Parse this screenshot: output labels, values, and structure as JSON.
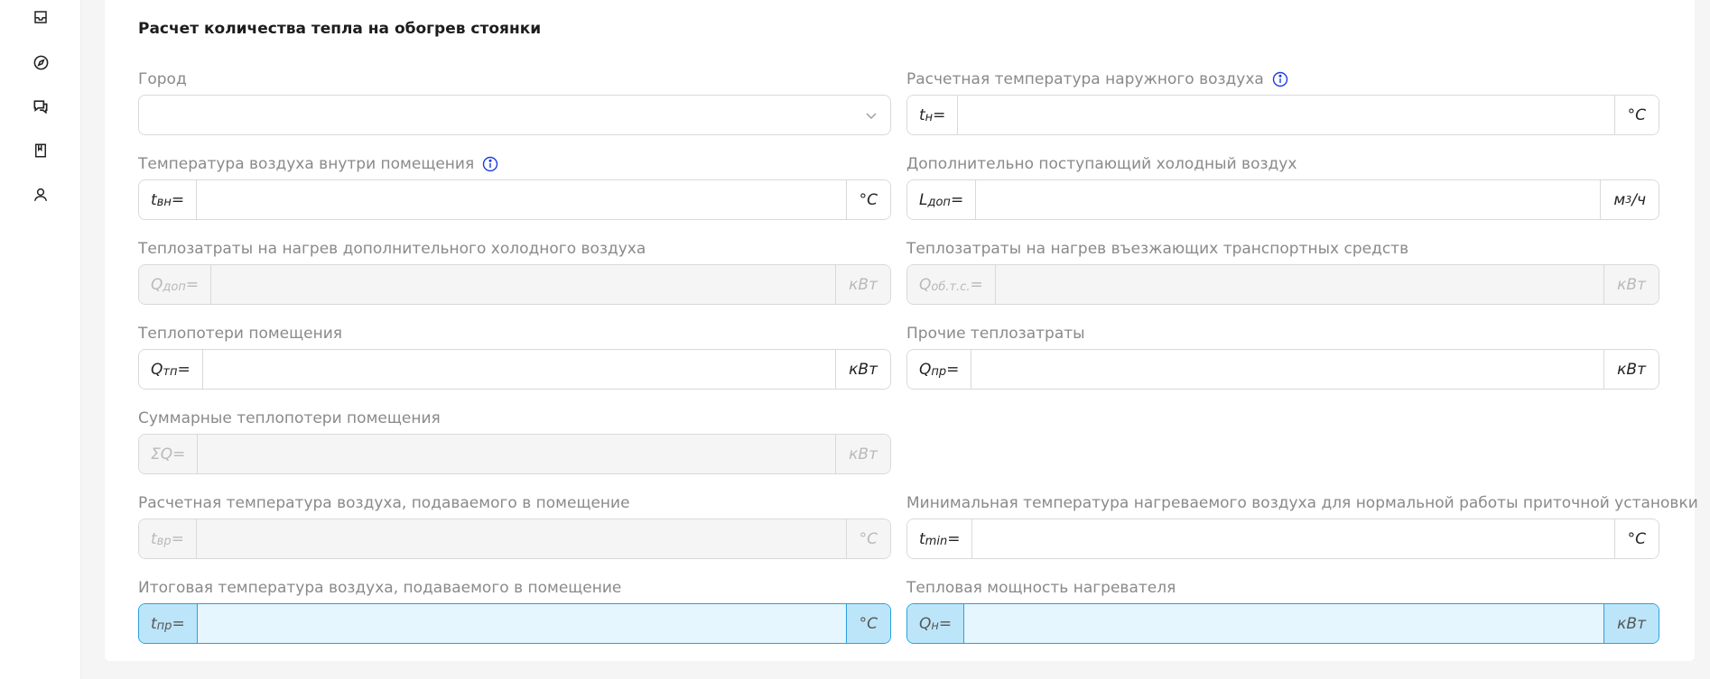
{
  "sidebar": {
    "icons": [
      "inbox-icon",
      "compass-icon",
      "chat-icon",
      "book-icon",
      "user-icon"
    ]
  },
  "form": {
    "title": "Расчет количества тепла на обогрев стоянки",
    "city": {
      "label": "Город",
      "value": ""
    },
    "t_outdoor": {
      "label": "Расчетная температура наружного воздуха",
      "prefix": "t",
      "sub": "н",
      "eq": " =",
      "unit": "°C"
    },
    "t_indoor": {
      "label": "Температура воздуха внутри помещения",
      "prefix": "t",
      "sub": "вн",
      "eq": " =",
      "unit": "°C"
    },
    "l_extra": {
      "label": "Дополнительно поступающий холодный воздух",
      "prefix": "L",
      "sub": "доп",
      "eq": " =",
      "unit": "м",
      "unit_sup": "3",
      "unit_tail": "/ч"
    },
    "q_extra": {
      "label": "Теплозатраты на нагрев дополнительного холодного воздуха",
      "prefix": "Q",
      "sub": "доп",
      "eq": " =",
      "unit": "кВт"
    },
    "q_vehicles": {
      "label": "Теплозатраты на нагрев въезжающих транспортных средств",
      "prefix": "Q",
      "sub": "об.т.с.",
      "eq": " =",
      "unit": "кВт"
    },
    "q_losses": {
      "label": "Теплопотери помещения",
      "prefix": "Q",
      "sub": "тп",
      "eq": " =",
      "unit": "кВт"
    },
    "q_other": {
      "label": "Прочие теплозатраты",
      "prefix": "Q",
      "sub": "пр",
      "eq": " =",
      "unit": "кВт"
    },
    "q_total": {
      "label": "Суммарные теплопотери помещения",
      "prefix": "ΣQ",
      "eq": " =",
      "unit": "кВт"
    },
    "t_supply_calc": {
      "label": "Расчетная температура воздуха, подаваемого в помещение",
      "prefix": "t",
      "sub": "вр",
      "eq": " =",
      "unit": "°C"
    },
    "t_min": {
      "label": "Минимальная температура нагреваемого воздуха для нормальной работы приточной установки",
      "prefix": "t",
      "sub": "min",
      "eq": " =",
      "unit": "°C"
    },
    "t_supply_final": {
      "label": "Итоговая температура воздуха, подаваемого в помещение",
      "prefix": "t",
      "sub": "пр",
      "eq": " =",
      "unit": "°C"
    },
    "q_heater": {
      "label": "Тепловая мощность нагревателя",
      "prefix": "Q",
      "sub": "н",
      "eq": " =",
      "unit": "кВт"
    }
  },
  "colors": {
    "highlight_border": "#2ba0dd",
    "highlight_bg": "#e6f6fe",
    "highlight_addon": "#bde5f9",
    "info_icon": "#1a3ce0"
  }
}
